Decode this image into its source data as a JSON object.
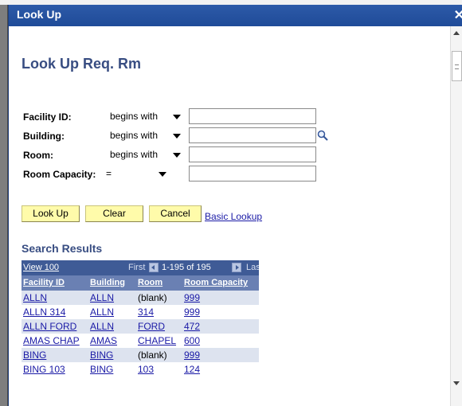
{
  "window": {
    "title": "Look Up"
  },
  "page_title": "Look Up Req. Rm",
  "form": {
    "fields": [
      {
        "label": "Facility ID:",
        "operator": "begins with",
        "value": ""
      },
      {
        "label": "Building:",
        "operator": "begins with",
        "value": ""
      },
      {
        "label": "Room:",
        "operator": "begins with",
        "value": ""
      },
      {
        "label": "Room Capacity:",
        "operator": "=",
        "value": ""
      }
    ]
  },
  "buttons": {
    "lookup": "Look Up",
    "clear": "Clear",
    "cancel": "Cancel",
    "basic_lookup": "Basic Lookup"
  },
  "results": {
    "title": "Search Results",
    "view_link": "View 100",
    "first": "First",
    "range": "1-195 of 195",
    "last": "Last",
    "columns": [
      "Facility ID",
      "Building",
      "Room",
      "Room Capacity"
    ],
    "rows": [
      [
        "ALLN",
        "ALLN",
        "(blank)",
        "999"
      ],
      [
        "ALLN 314",
        "ALLN",
        "314",
        "999"
      ],
      [
        "ALLN FORD",
        "ALLN",
        "FORD",
        "472"
      ],
      [
        "AMAS CHAP",
        "AMAS",
        "CHAPEL",
        "600"
      ],
      [
        "BING",
        "BING",
        "(blank)",
        "999"
      ],
      [
        "BING 103",
        "BING",
        "103",
        "124"
      ]
    ]
  },
  "colors": {
    "title_blue": "#384d82",
    "grid_header": "#3f5b96",
    "row_alt_a": "#dde3ef",
    "row_alt_b": "#ffffff",
    "button_yellow": "#fffbaa"
  }
}
